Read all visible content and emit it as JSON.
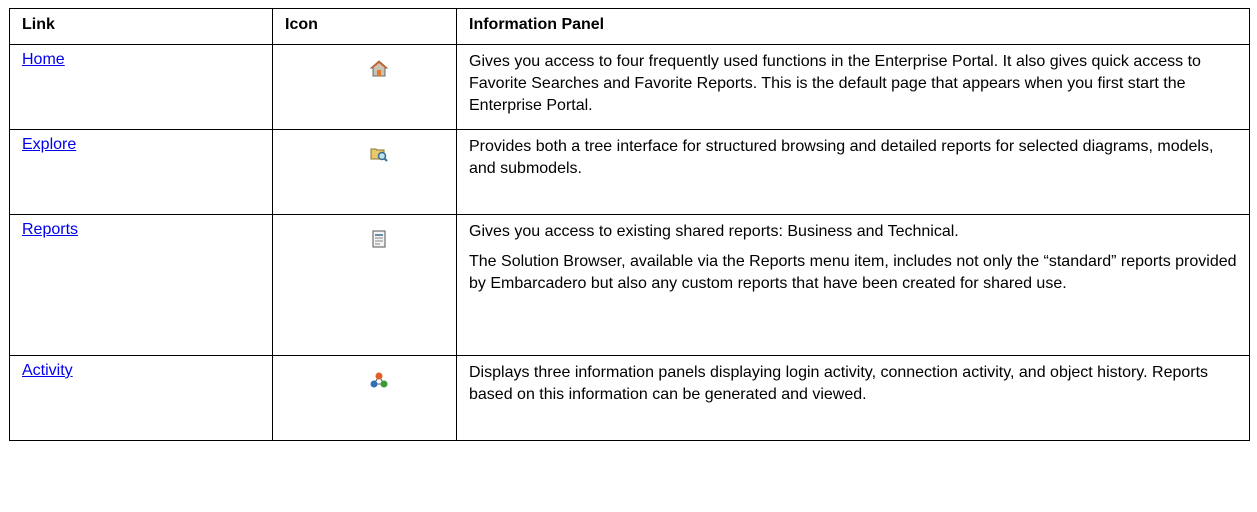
{
  "table": {
    "headers": [
      "Link",
      "Icon",
      "Information Panel"
    ],
    "rows": [
      {
        "link": "Home",
        "icon": "home-icon",
        "info": [
          "Gives you access to four frequently used functions in the Enterprise Portal. It also gives quick access to Favorite Searches and Favorite Reports. This is the default page that appears when you first start the Enterprise Portal."
        ]
      },
      {
        "link": "Explore",
        "icon": "explore-folder-search-icon",
        "info": [
          "Provides both a tree interface for structured browsing and detailed reports for selected diagrams, models, and submodels."
        ]
      },
      {
        "link": "Reports",
        "icon": "report-document-icon",
        "info": [
          "Gives you access to existing shared reports: Business and Technical.",
          "The Solution Browser, available via the Reports menu item, includes not only the “standard” reports provided by Embarcadero but also any custom reports that have been created for shared use."
        ]
      },
      {
        "link": "Activity",
        "icon": "activity-network-icon",
        "info": [
          "Displays three information panels displaying login activity, connection activity, and object history. Reports based on this information can be generated and viewed."
        ]
      }
    ]
  }
}
